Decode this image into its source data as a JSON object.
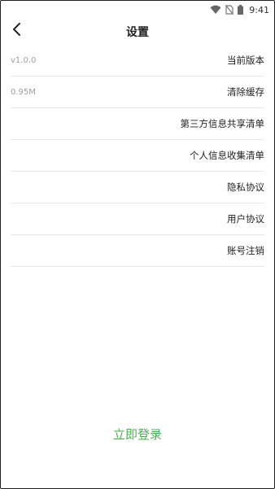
{
  "status_bar": {
    "time": "9:41",
    "icons": [
      "wifi-icon",
      "no-sim-icon",
      "battery-icon"
    ]
  },
  "header": {
    "title": "设置",
    "back_icon": "chevron-left-icon"
  },
  "settings": {
    "items": [
      {
        "value": "v1.0.0",
        "label": "当前版本"
      },
      {
        "value": "0.95M",
        "label": "清除缓存"
      },
      {
        "value": "",
        "label": "第三方信息共享清单"
      },
      {
        "value": "",
        "label": "个人信息收集清单"
      },
      {
        "value": "",
        "label": "隐私协议"
      },
      {
        "value": "",
        "label": "用户协议"
      },
      {
        "value": "",
        "label": "账号注销"
      }
    ]
  },
  "login": {
    "label": "立即登录"
  },
  "colors": {
    "accent": "#4caf50",
    "divider": "#e8e8e8",
    "secondary_text": "#a0a0a0"
  }
}
